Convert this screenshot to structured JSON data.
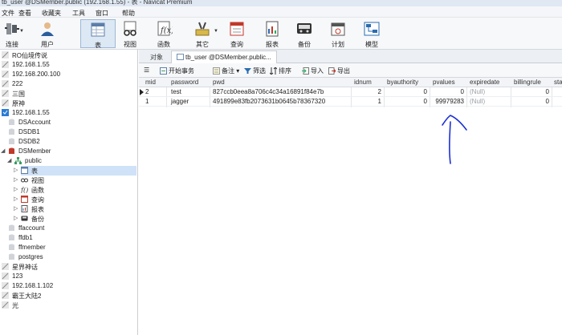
{
  "titlebar": {
    "text": "tb_user @DSMember.public (192.168.1.55) - 表 - Navicat Premium"
  },
  "menu": [
    "文件",
    "查看",
    "收藏夹",
    "工具",
    "窗口",
    "帮助"
  ],
  "toolbar": [
    {
      "label": "连接",
      "icon": "connection-icon"
    },
    {
      "label": "用户",
      "icon": "user-icon"
    },
    {
      "label": "表",
      "icon": "table-icon"
    },
    {
      "label": "视图",
      "icon": "view-icon"
    },
    {
      "label": "函数",
      "icon": "function-icon"
    },
    {
      "label": "其它",
      "icon": "other-icon"
    },
    {
      "label": "查询",
      "icon": "query-icon"
    },
    {
      "label": "报表",
      "icon": "report-icon"
    },
    {
      "label": "备份",
      "icon": "backup-icon"
    },
    {
      "label": "计划",
      "icon": "schedule-icon"
    },
    {
      "label": "模型",
      "icon": "model-icon"
    }
  ],
  "sidebar": {
    "connections": [
      "RO仙境传说",
      "192.168.1.55",
      "192.168.200.100",
      "222",
      "三国",
      "原神",
      "192.168.1.55"
    ],
    "databases": [
      "DSAccount",
      "DSDB1",
      "DSDB2",
      "DSMember"
    ],
    "schema": "public",
    "schema_items": [
      "表",
      "视图",
      "函数",
      "查询",
      "报表",
      "备份"
    ],
    "more_databases": [
      "ffaccount",
      "ffdb1",
      "ffmember",
      "postgres"
    ],
    "more_connections": [
      "星界神话",
      "123",
      "192.168.1.102",
      "霸王大陆2",
      "光"
    ]
  },
  "tabs": {
    "objects": "对象",
    "active": "tb_user @DSMember.public..."
  },
  "subtoolbar": {
    "begin_transaction": "开始事务",
    "note": "备注",
    "filter": "筛选",
    "sort": "排序",
    "import": "导入",
    "export": "导出"
  },
  "grid": {
    "columns": [
      "mid",
      "password",
      "pwd",
      "idnum",
      "byauthority",
      "pvalues",
      "expiredate",
      "billingrule",
      "sta"
    ],
    "rows": [
      {
        "mid": "2",
        "password": "test",
        "pwd": "827ccb0eea8a706c4c34a16891f84e7b",
        "idnum": "2",
        "byauthority": "0",
        "pvalues": "0",
        "expiredate": "(Null)",
        "billingrule": "0"
      },
      {
        "mid": "1",
        "password": "jagger",
        "pwd": "491899e83fb2073631b0645b78367320",
        "idnum": "1",
        "byauthority": "0",
        "pvalues": "99979283",
        "expiredate": "(Null)",
        "billingrule": "0"
      }
    ]
  },
  "colors": {
    "selection": "#cfe2f7",
    "annotation": "#1a2fd6",
    "null_text": "#9aa0a6"
  }
}
